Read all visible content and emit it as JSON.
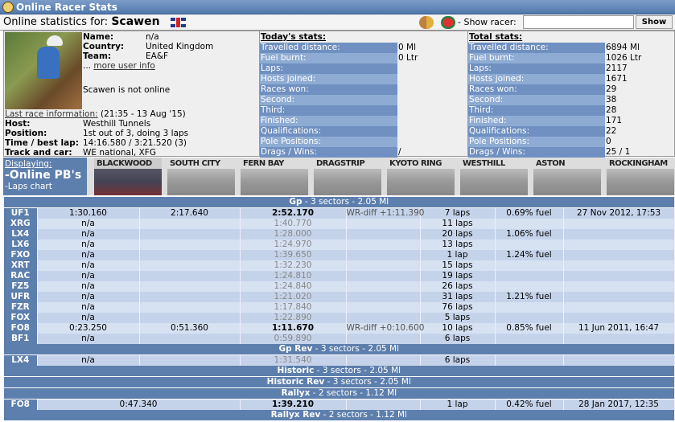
{
  "window_title": "Online Racer Stats",
  "header": {
    "prefix": "Online statistics for:",
    "racer": "Scawen",
    "show_racer_label": "- Show racer:",
    "input_value": "",
    "show_button": "Show"
  },
  "profile": {
    "name_label": "Name:",
    "name": "n/a",
    "country_label": "Country:",
    "country": "United Kingdom",
    "team_label": "Team:",
    "team": "EA&F",
    "more_prefix": "...",
    "more_link": "more user info",
    "status": "Scawen is not online"
  },
  "last_race": {
    "link": "Last race information:",
    "when": "(21:35 - 13 Aug '15)",
    "host_label": "Host:",
    "host": "Westhill Tunnels",
    "position_label": "Position:",
    "position": "1st out of 3, doing 3 laps",
    "time_label": "Time / best lap:",
    "time": "14:16.580 / 3:21.520 (3)",
    "track_label": "Track and car:",
    "track": "WE national, XFG"
  },
  "today": {
    "title": "Today's stats:",
    "rows": [
      [
        "Travelled distance:",
        "0 Ml"
      ],
      [
        "Fuel burnt:",
        "0 Ltr"
      ],
      [
        "Laps:",
        ""
      ],
      [
        "Hosts joined:",
        ""
      ],
      [
        "Races won:",
        ""
      ],
      [
        "Second:",
        ""
      ],
      [
        "Third:",
        ""
      ],
      [
        "Finished:",
        ""
      ],
      [
        "Qualifications:",
        ""
      ],
      [
        "Pole Positions:",
        ""
      ],
      [
        "Drags / Wins:",
        "/"
      ]
    ]
  },
  "total": {
    "title": "Total stats:",
    "rows": [
      [
        "Travelled distance:",
        "6894 Ml"
      ],
      [
        "Fuel burnt:",
        "1026 Ltr"
      ],
      [
        "Laps:",
        "2117"
      ],
      [
        "Hosts joined:",
        "1671"
      ],
      [
        "Races won:",
        "29"
      ],
      [
        "Second:",
        "38"
      ],
      [
        "Third:",
        "28"
      ],
      [
        "Finished:",
        "171"
      ],
      [
        "Qualifications:",
        "22"
      ],
      [
        "Pole Positions:",
        "0"
      ],
      [
        "Drags / Wins:",
        "25 / 1"
      ]
    ]
  },
  "displaying": {
    "label": "Displaying:",
    "current": "-Online PB's",
    "other": "-Laps chart"
  },
  "tracks": [
    "BLACKWOOD",
    "SOUTH CITY",
    "FERN BAY",
    "DRAGSTRIP",
    "KYOTO RING",
    "WESTHILL",
    "ASTON",
    "ROCKINGHAM"
  ],
  "sections": [
    {
      "name": "Gp",
      "info": "- 3 sectors - 2.05 Ml",
      "rows": [
        [
          "UF1",
          "1:30.160",
          "2:17.640",
          "2:52.170",
          "WR-diff +1:11.390",
          "7 laps",
          "0.69% fuel",
          "27 Nov 2012, 17:53"
        ],
        [
          "XRG",
          "n/a",
          "",
          "1:40.770",
          "",
          "11 laps",
          "",
          ""
        ],
        [
          "LX4",
          "n/a",
          "",
          "1:28.000",
          "",
          "20 laps",
          "1.06% fuel",
          ""
        ],
        [
          "LX6",
          "n/a",
          "",
          "1:24.970",
          "",
          "13 laps",
          "",
          ""
        ],
        [
          "FXO",
          "n/a",
          "",
          "1:39.650",
          "",
          "1 lap",
          "1.24% fuel",
          ""
        ],
        [
          "XRT",
          "n/a",
          "",
          "1:32.230",
          "",
          "15 laps",
          "",
          ""
        ],
        [
          "RAC",
          "n/a",
          "",
          "1:24.810",
          "",
          "19 laps",
          "",
          ""
        ],
        [
          "FZ5",
          "n/a",
          "",
          "1:24.840",
          "",
          "26 laps",
          "",
          ""
        ],
        [
          "UFR",
          "n/a",
          "",
          "1:21.020",
          "",
          "31 laps",
          "1.21% fuel",
          ""
        ],
        [
          "FZR",
          "n/a",
          "",
          "1:17.840",
          "",
          "76 laps",
          "",
          ""
        ],
        [
          "FOX",
          "n/a",
          "",
          "1:22.890",
          "",
          "5 laps",
          "",
          ""
        ],
        [
          "FO8",
          "0:23.250",
          "0:51.360",
          "1:11.670",
          "WR-diff +0:10.600",
          "10 laps",
          "0.85% fuel",
          "11 Jun 2011, 16:47"
        ],
        [
          "BF1",
          "n/a",
          "",
          "0:59.890",
          "",
          "6 laps",
          "",
          ""
        ]
      ]
    },
    {
      "name": "Gp Rev",
      "info": "- 3 sectors - 2.05 Ml",
      "rows": [
        [
          "LX4",
          "n/a",
          "",
          "1:31.540",
          "",
          "6 laps",
          "",
          ""
        ]
      ]
    },
    {
      "name": "Historic",
      "info": "- 3 sectors - 2.05 Ml",
      "rows": []
    },
    {
      "name": "Historic Rev",
      "info": "- 3 sectors - 2.05 Ml",
      "rows": []
    },
    {
      "name": "Rallyx",
      "info": "- 2 sectors - 1.12 Ml",
      "two_sector": true,
      "rows": [
        [
          "FO8",
          "0:47.340",
          "1:39.210",
          "",
          "1 lap",
          "0.42% fuel",
          "28 Jan 2017, 12:35"
        ]
      ]
    },
    {
      "name": "Rallyx Rev",
      "info": "- 2 sectors - 1.12 Ml",
      "rows": []
    }
  ]
}
